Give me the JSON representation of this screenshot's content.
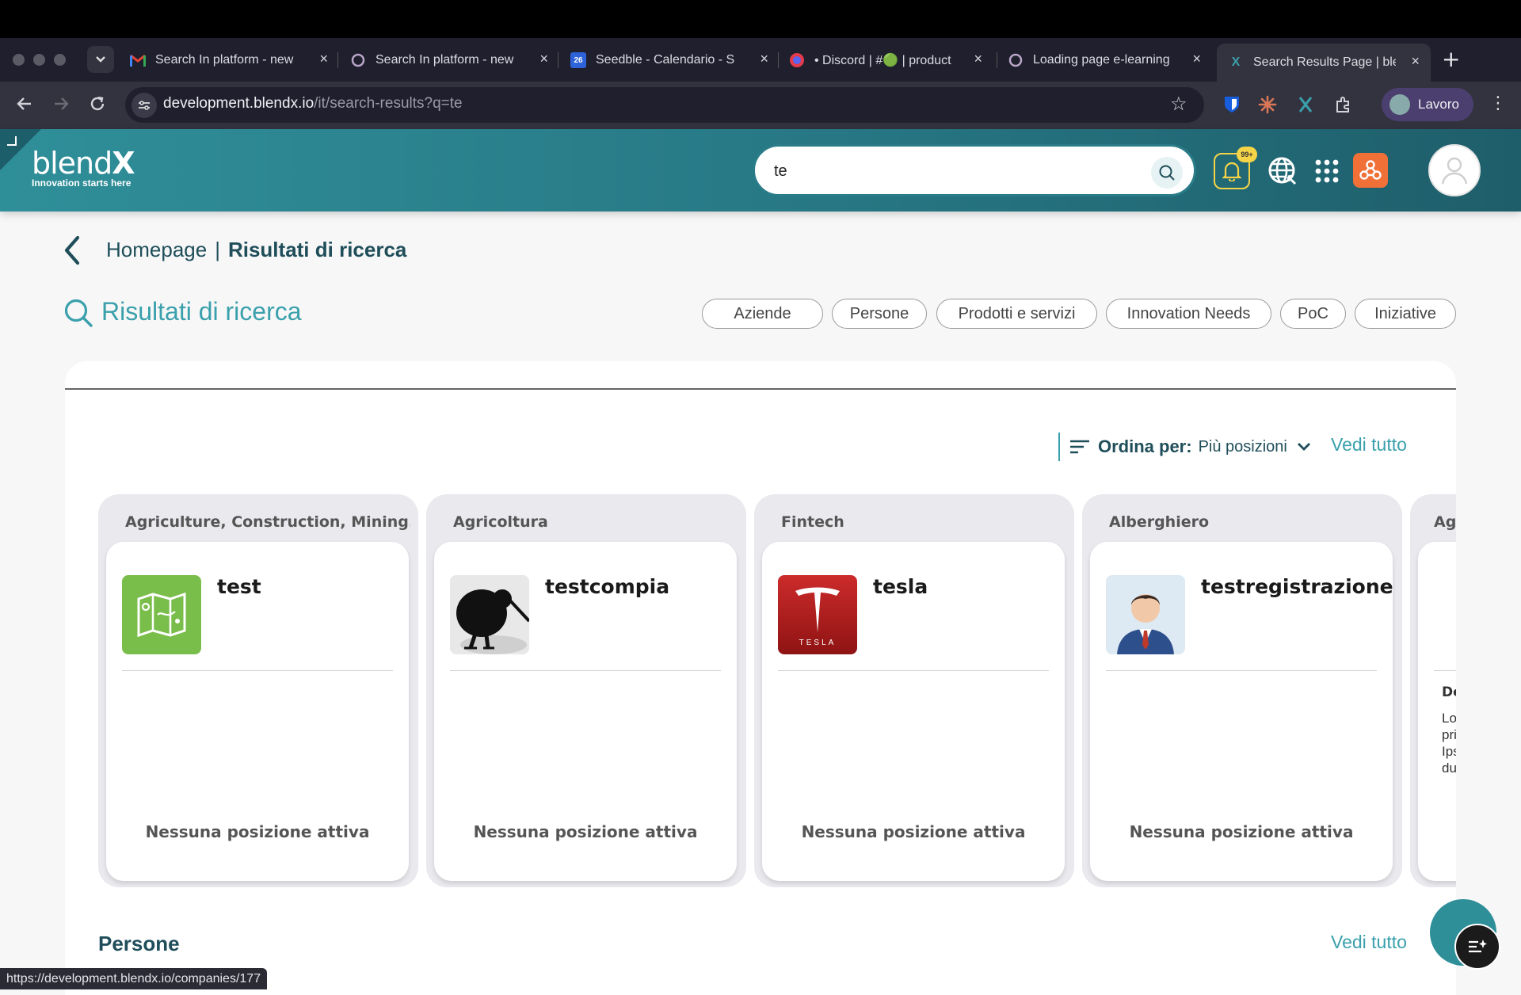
{
  "browser": {
    "tabs": [
      {
        "title": "Search In platform - new",
        "icon": "gmail-icon"
      },
      {
        "title": "Search In platform - new",
        "icon": "circle-icon"
      },
      {
        "title": "Seedble - Calendario - S",
        "icon": "calendar-icon",
        "icon_text": "26"
      },
      {
        "title": "• Discord | #🟢 | product",
        "icon": "discord-icon"
      },
      {
        "title": "Loading page e-learning",
        "icon": "circle-icon"
      },
      {
        "title": "Search Results Page | ble",
        "icon": "blendx-icon"
      }
    ],
    "url_host": "development.blendx.io",
    "url_path": "/it/search-results?q=te",
    "profile_label": "Lavoro",
    "status_url": "https://development.blendx.io/companies/177"
  },
  "app": {
    "logo_text_light": "blend",
    "logo_text_bold": "X",
    "logo_tagline": "Innovation starts here",
    "search_value": "te",
    "notification_badge": "99+"
  },
  "breadcrumb": {
    "home": "Homepage",
    "separator": "|",
    "current": "Risultati di ricerca"
  },
  "page_title": "Risultati di ricerca",
  "filters": [
    "Aziende",
    "Persone",
    "Prodotti e servizi",
    "Innovation Needs",
    "PoC",
    "Iniziative"
  ],
  "sort": {
    "label": "Ordina per:",
    "value": "Più posizioni"
  },
  "see_all": "Vedi tutto",
  "companies": [
    {
      "category": "Agriculture, Construction, Mining...",
      "name": "test",
      "status": "Nessuna posizione attiva"
    },
    {
      "category": "Agricoltura",
      "name": "testcompia",
      "status": "Nessuna posizione attiva"
    },
    {
      "category": "Fintech",
      "name": "tesla",
      "status": "Nessuna posizione attiva"
    },
    {
      "category": "Alberghiero",
      "name": "testregistrazione",
      "status": "Nessuna posizione attiva"
    },
    {
      "category": "Ag",
      "name": "",
      "desc_label": "De",
      "desc_lines": [
        "Lor",
        "prin",
        "Ipsu",
        "dur"
      ]
    }
  ],
  "section_people": "Persone",
  "colors": {
    "accent": "#3aa0ac",
    "header_start": "#2f8f99",
    "header_end": "#1e5e6a",
    "title_dark": "#1f4e5a",
    "notification": "#f5d547"
  }
}
